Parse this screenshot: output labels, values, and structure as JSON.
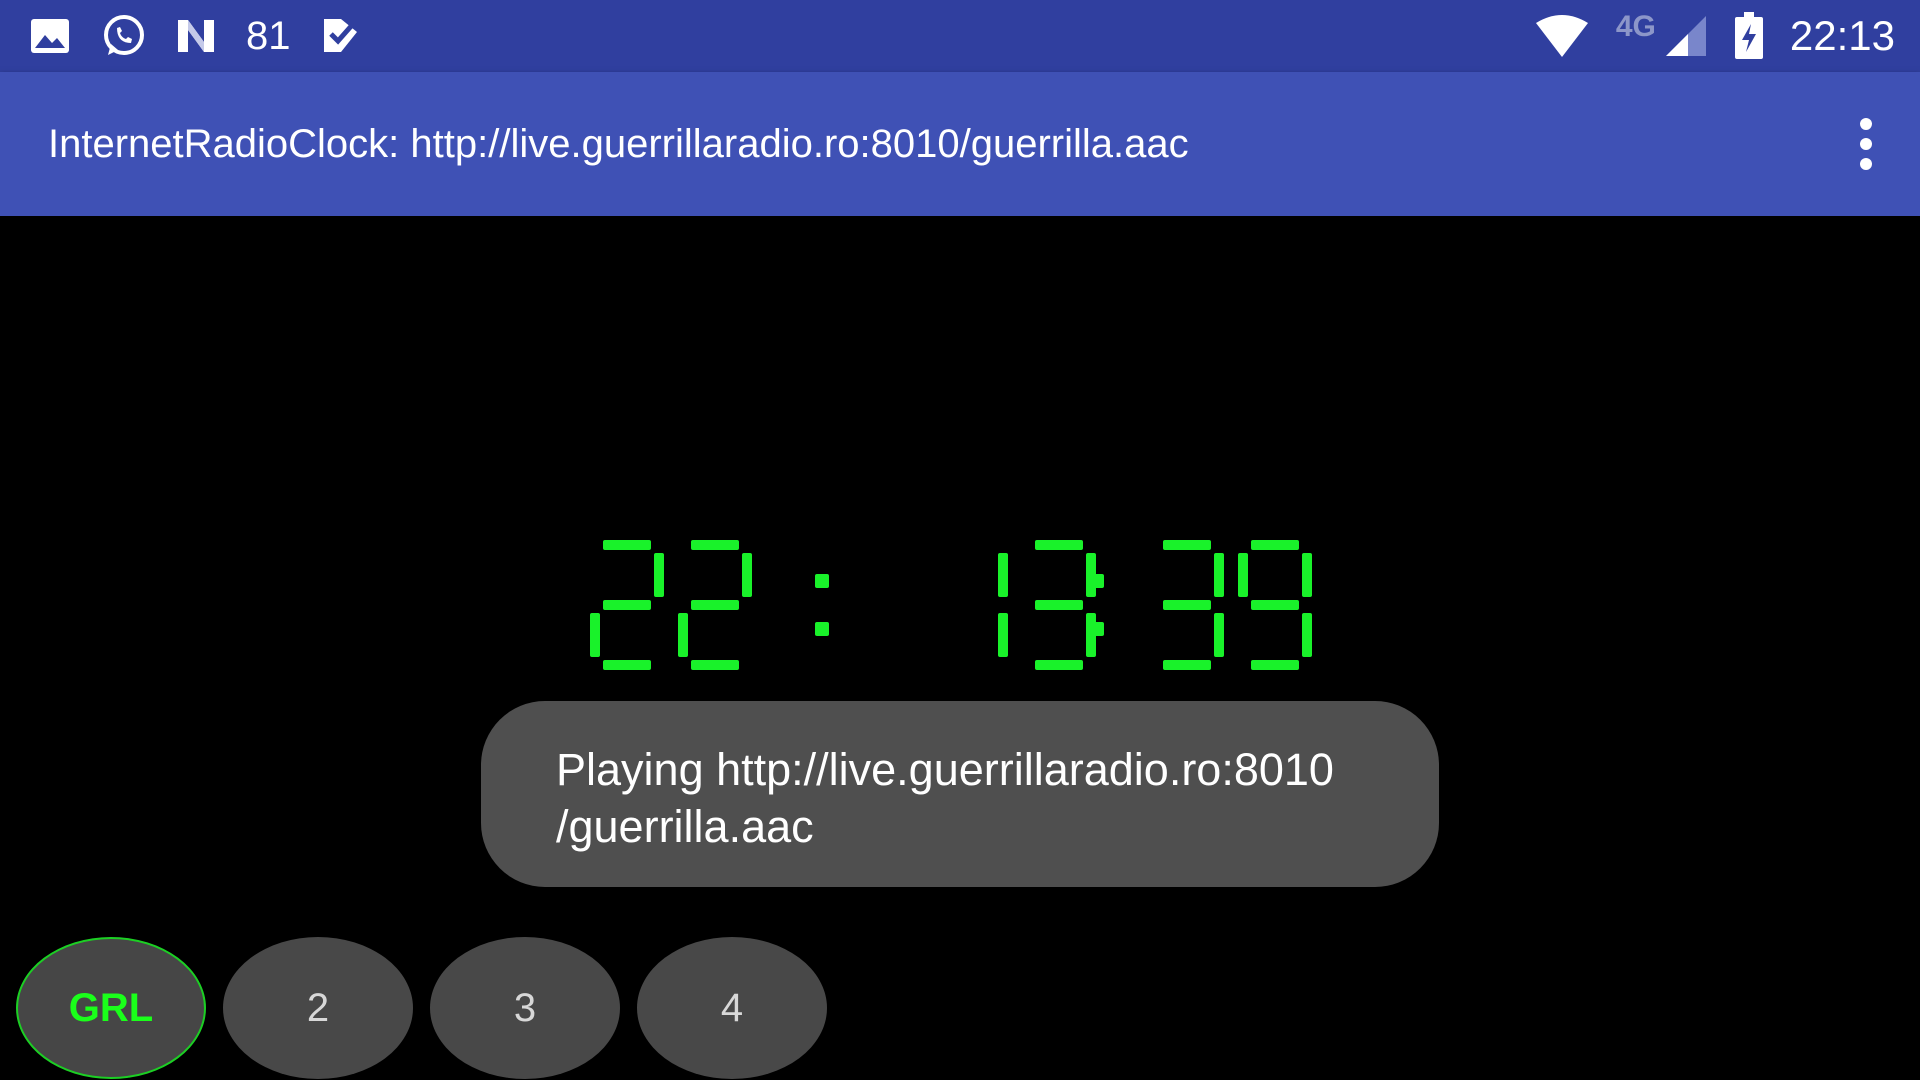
{
  "status_bar": {
    "notification_count": "81",
    "network_type": "4G",
    "time": "22:13"
  },
  "app_bar": {
    "title": "InternetRadioClock: http://live.guerrillaradio.ro:8010/guerrilla.aac"
  },
  "clock": {
    "hours": "22",
    "minutes": "13",
    "seconds": "39",
    "color": "#19f22a"
  },
  "toast": {
    "line1": "Playing http://live.guerrillaradio.ro:8010",
    "line2": "/guerrilla.aac"
  },
  "presets": [
    {
      "label": "GRL",
      "active": true
    },
    {
      "label": "2",
      "active": false
    },
    {
      "label": "3",
      "active": false
    },
    {
      "label": "4",
      "active": false
    }
  ],
  "colors": {
    "status_bar": "#303F9F",
    "app_bar": "#3F51B5",
    "accent_green": "#1aff1a"
  }
}
